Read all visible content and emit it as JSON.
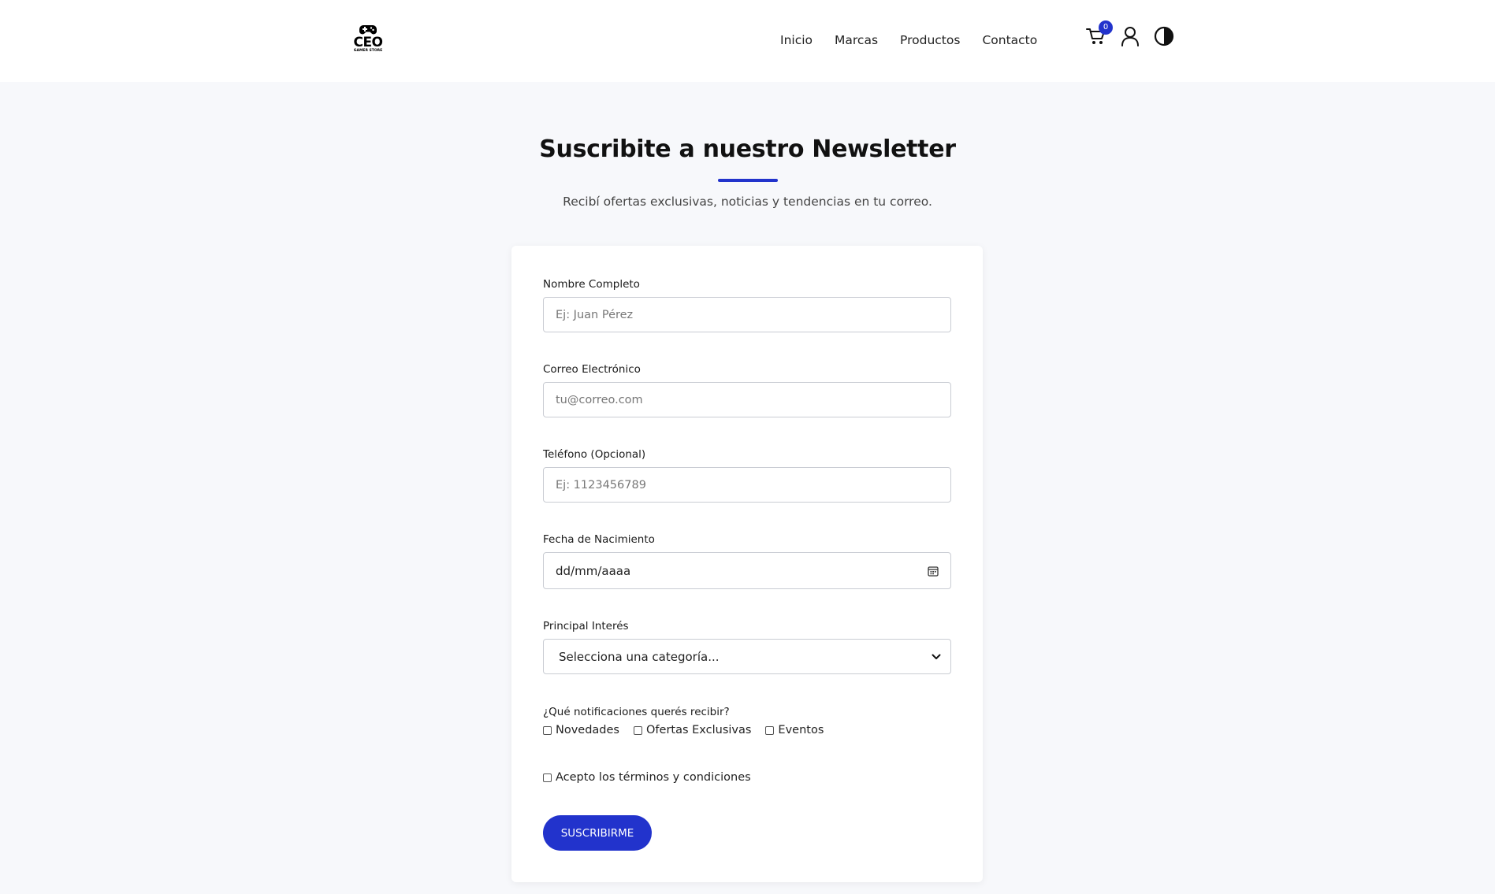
{
  "brand": {
    "logo_text": "CEO",
    "logo_subtext": "GAMER STORE"
  },
  "nav": {
    "items": [
      "Inicio",
      "Marcas",
      "Productos",
      "Contacto"
    ]
  },
  "header_icons": {
    "cart_icon": "cart-icon",
    "cart_count": "0",
    "user_icon": "user-icon",
    "theme_icon": "contrast-icon"
  },
  "hero": {
    "title": "Suscribite a nuestro Newsletter",
    "subtitle": "Recibí ofertas exclusivas, noticias y tendencias en tu correo."
  },
  "form": {
    "name": {
      "label": "Nombre Completo",
      "placeholder": "Ej: Juan Pérez",
      "value": ""
    },
    "email": {
      "label": "Correo Electrónico",
      "placeholder": "tu@correo.com",
      "value": ""
    },
    "phone": {
      "label": "Teléfono (Opcional)",
      "placeholder": "Ej: 1123456789",
      "value": ""
    },
    "birthdate": {
      "label": "Fecha de Nacimiento",
      "value": "dd/mm/aaaa"
    },
    "interest": {
      "label": "Principal Interés",
      "selected": "Selecciona una categoría..."
    },
    "notifications": {
      "label": "¿Qué notificaciones querés recibir?",
      "options": [
        "Novedades",
        "Ofertas Exclusivas",
        "Eventos"
      ]
    },
    "terms": {
      "label": "Acepto los términos y condiciones"
    },
    "submit_label": "SUSCRIBIRME"
  },
  "colors": {
    "accent": "#2233cc",
    "page_background": "#f7f8fb"
  }
}
